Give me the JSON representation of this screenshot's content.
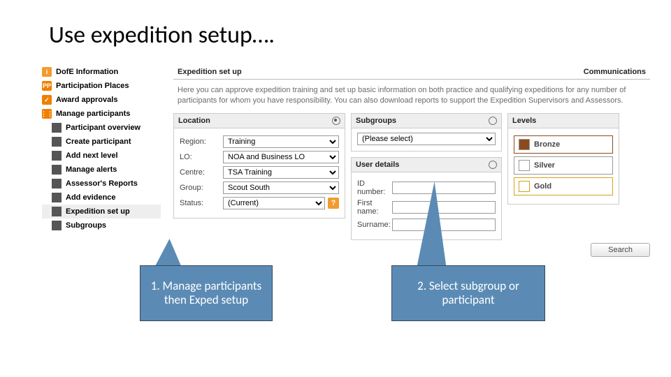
{
  "slide_title": "Use expedition setup….",
  "header": {
    "title": "Expedition set up",
    "comms": "Communications"
  },
  "intro": "Here you can approve expedition training and set up basic information on both practice and qualifying expeditions for any number of participants for whom you have responsibility. You can also download reports to support the Expedition Supervisors and Assessors.",
  "nav": {
    "top": [
      {
        "label": "DofE Information",
        "icon": "i"
      },
      {
        "label": "Participation Places",
        "icon": "PP"
      },
      {
        "label": "Award approvals",
        "icon": "✓"
      },
      {
        "label": "Manage participants",
        "icon": "⋮⋮"
      }
    ],
    "sub": [
      {
        "label": "Participant overview"
      },
      {
        "label": "Create participant"
      },
      {
        "label": "Add next level"
      },
      {
        "label": "Manage alerts"
      },
      {
        "label": "Assessor's Reports"
      },
      {
        "label": "Add evidence"
      },
      {
        "label": "Expedition set up"
      },
      {
        "label": "Subgroups"
      }
    ]
  },
  "location": {
    "title": "Location",
    "region_label": "Region:",
    "region_value": "Training",
    "lo_label": "LO:",
    "lo_value": "NOA and Business LO",
    "centre_label": "Centre:",
    "centre_value": "TSA Training",
    "group_label": "Group:",
    "group_value": "Scout South",
    "status_label": "Status:",
    "status_value": "(Current)"
  },
  "subgroups": {
    "title": "Subgroups",
    "selected": "(Please select)"
  },
  "user": {
    "title": "User details",
    "id_label": "ID number:",
    "first_label": "First name:",
    "surname_label": "Surname:"
  },
  "levels": {
    "title": "Levels",
    "bronze": "Bronze",
    "silver": "Silver",
    "gold": "Gold"
  },
  "buttons": {
    "search": "Search"
  },
  "callouts": {
    "c1": "1. Manage participants then Exped setup",
    "c2": "2. Select subgroup or participant"
  }
}
